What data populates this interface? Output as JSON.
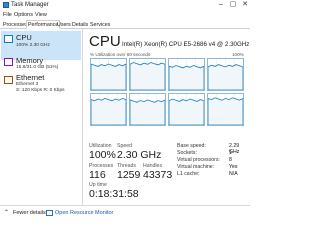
{
  "window": {
    "title": "Task Manager"
  },
  "menu": [
    "File",
    "Options",
    "View"
  ],
  "tabs": [
    "Processes",
    "Performance",
    "Users",
    "Details",
    "Services"
  ],
  "sidebar": {
    "items": [
      {
        "name": "CPU",
        "detail": "100% 2.30 GHz"
      },
      {
        "name": "Memory",
        "detail": "15.8/31.0 GB (51%)"
      },
      {
        "name": "Ethernet",
        "detail": "Ethernet 3",
        "detail2": "S: 120 Kbps R: 0 Kbps"
      }
    ]
  },
  "main": {
    "title": "CPU",
    "model": "Intel(R) Xeon(R) CPU E5-2686 v4 @ 2.30GHz",
    "graph_caption": "% Utilization over 60 seconds",
    "graph_max": "100%",
    "graph_cells": [
      {
        "level": 0.8
      },
      {
        "level": 0.85
      },
      {
        "level": 0.75
      },
      {
        "level": 0.78
      },
      {
        "level": 0.82
      },
      {
        "level": 0.77
      },
      {
        "level": 0.8
      },
      {
        "level": 0.84
      }
    ],
    "stats": {
      "utilization": {
        "label": "Utilization",
        "value": "100%"
      },
      "speed": {
        "label": "Speed",
        "value": "2.30 GHz"
      },
      "processes": {
        "label": "Processes",
        "value": "116"
      },
      "threads": {
        "label": "Threads",
        "value": "1259"
      },
      "handles": {
        "label": "Handles",
        "value": "43373"
      },
      "uptime": {
        "label": "Up time",
        "value": "0:18:31:58"
      }
    },
    "details": [
      {
        "label": "Base speed:",
        "value": "2.29 GHz"
      },
      {
        "label": "Sockets:",
        "value": "1"
      },
      {
        "label": "Virtual processors:",
        "value": "8"
      },
      {
        "label": "Virtual machine:",
        "value": "Yes"
      },
      {
        "label": "L1 cache:",
        "value": "N/A"
      }
    ]
  },
  "footer": {
    "fewer_details": "Fewer details",
    "resource_monitor": "Open Resource Monitor"
  },
  "colors": {
    "accent": "#117dbb",
    "selected": "#cce4f7",
    "memory": "#8b12ae",
    "ethernet": "#a74f01"
  }
}
